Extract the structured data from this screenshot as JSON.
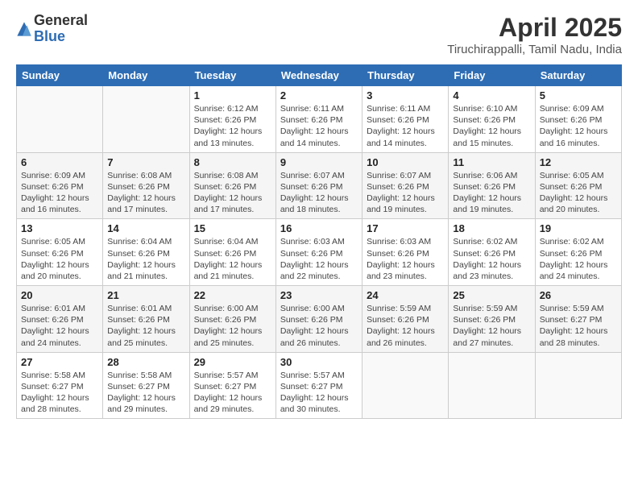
{
  "logo": {
    "general": "General",
    "blue": "Blue"
  },
  "title": "April 2025",
  "subtitle": "Tiruchirappalli, Tamil Nadu, India",
  "days_of_week": [
    "Sunday",
    "Monday",
    "Tuesday",
    "Wednesday",
    "Thursday",
    "Friday",
    "Saturday"
  ],
  "weeks": [
    [
      {
        "day": "",
        "sunrise": "",
        "sunset": "",
        "daylight": ""
      },
      {
        "day": "",
        "sunrise": "",
        "sunset": "",
        "daylight": ""
      },
      {
        "day": "1",
        "sunrise": "Sunrise: 6:12 AM",
        "sunset": "Sunset: 6:26 PM",
        "daylight": "Daylight: 12 hours and 13 minutes."
      },
      {
        "day": "2",
        "sunrise": "Sunrise: 6:11 AM",
        "sunset": "Sunset: 6:26 PM",
        "daylight": "Daylight: 12 hours and 14 minutes."
      },
      {
        "day": "3",
        "sunrise": "Sunrise: 6:11 AM",
        "sunset": "Sunset: 6:26 PM",
        "daylight": "Daylight: 12 hours and 14 minutes."
      },
      {
        "day": "4",
        "sunrise": "Sunrise: 6:10 AM",
        "sunset": "Sunset: 6:26 PM",
        "daylight": "Daylight: 12 hours and 15 minutes."
      },
      {
        "day": "5",
        "sunrise": "Sunrise: 6:09 AM",
        "sunset": "Sunset: 6:26 PM",
        "daylight": "Daylight: 12 hours and 16 minutes."
      }
    ],
    [
      {
        "day": "6",
        "sunrise": "Sunrise: 6:09 AM",
        "sunset": "Sunset: 6:26 PM",
        "daylight": "Daylight: 12 hours and 16 minutes."
      },
      {
        "day": "7",
        "sunrise": "Sunrise: 6:08 AM",
        "sunset": "Sunset: 6:26 PM",
        "daylight": "Daylight: 12 hours and 17 minutes."
      },
      {
        "day": "8",
        "sunrise": "Sunrise: 6:08 AM",
        "sunset": "Sunset: 6:26 PM",
        "daylight": "Daylight: 12 hours and 17 minutes."
      },
      {
        "day": "9",
        "sunrise": "Sunrise: 6:07 AM",
        "sunset": "Sunset: 6:26 PM",
        "daylight": "Daylight: 12 hours and 18 minutes."
      },
      {
        "day": "10",
        "sunrise": "Sunrise: 6:07 AM",
        "sunset": "Sunset: 6:26 PM",
        "daylight": "Daylight: 12 hours and 19 minutes."
      },
      {
        "day": "11",
        "sunrise": "Sunrise: 6:06 AM",
        "sunset": "Sunset: 6:26 PM",
        "daylight": "Daylight: 12 hours and 19 minutes."
      },
      {
        "day": "12",
        "sunrise": "Sunrise: 6:05 AM",
        "sunset": "Sunset: 6:26 PM",
        "daylight": "Daylight: 12 hours and 20 minutes."
      }
    ],
    [
      {
        "day": "13",
        "sunrise": "Sunrise: 6:05 AM",
        "sunset": "Sunset: 6:26 PM",
        "daylight": "Daylight: 12 hours and 20 minutes."
      },
      {
        "day": "14",
        "sunrise": "Sunrise: 6:04 AM",
        "sunset": "Sunset: 6:26 PM",
        "daylight": "Daylight: 12 hours and 21 minutes."
      },
      {
        "day": "15",
        "sunrise": "Sunrise: 6:04 AM",
        "sunset": "Sunset: 6:26 PM",
        "daylight": "Daylight: 12 hours and 21 minutes."
      },
      {
        "day": "16",
        "sunrise": "Sunrise: 6:03 AM",
        "sunset": "Sunset: 6:26 PM",
        "daylight": "Daylight: 12 hours and 22 minutes."
      },
      {
        "day": "17",
        "sunrise": "Sunrise: 6:03 AM",
        "sunset": "Sunset: 6:26 PM",
        "daylight": "Daylight: 12 hours and 23 minutes."
      },
      {
        "day": "18",
        "sunrise": "Sunrise: 6:02 AM",
        "sunset": "Sunset: 6:26 PM",
        "daylight": "Daylight: 12 hours and 23 minutes."
      },
      {
        "day": "19",
        "sunrise": "Sunrise: 6:02 AM",
        "sunset": "Sunset: 6:26 PM",
        "daylight": "Daylight: 12 hours and 24 minutes."
      }
    ],
    [
      {
        "day": "20",
        "sunrise": "Sunrise: 6:01 AM",
        "sunset": "Sunset: 6:26 PM",
        "daylight": "Daylight: 12 hours and 24 minutes."
      },
      {
        "day": "21",
        "sunrise": "Sunrise: 6:01 AM",
        "sunset": "Sunset: 6:26 PM",
        "daylight": "Daylight: 12 hours and 25 minutes."
      },
      {
        "day": "22",
        "sunrise": "Sunrise: 6:00 AM",
        "sunset": "Sunset: 6:26 PM",
        "daylight": "Daylight: 12 hours and 25 minutes."
      },
      {
        "day": "23",
        "sunrise": "Sunrise: 6:00 AM",
        "sunset": "Sunset: 6:26 PM",
        "daylight": "Daylight: 12 hours and 26 minutes."
      },
      {
        "day": "24",
        "sunrise": "Sunrise: 5:59 AM",
        "sunset": "Sunset: 6:26 PM",
        "daylight": "Daylight: 12 hours and 26 minutes."
      },
      {
        "day": "25",
        "sunrise": "Sunrise: 5:59 AM",
        "sunset": "Sunset: 6:26 PM",
        "daylight": "Daylight: 12 hours and 27 minutes."
      },
      {
        "day": "26",
        "sunrise": "Sunrise: 5:59 AM",
        "sunset": "Sunset: 6:27 PM",
        "daylight": "Daylight: 12 hours and 28 minutes."
      }
    ],
    [
      {
        "day": "27",
        "sunrise": "Sunrise: 5:58 AM",
        "sunset": "Sunset: 6:27 PM",
        "daylight": "Daylight: 12 hours and 28 minutes."
      },
      {
        "day": "28",
        "sunrise": "Sunrise: 5:58 AM",
        "sunset": "Sunset: 6:27 PM",
        "daylight": "Daylight: 12 hours and 29 minutes."
      },
      {
        "day": "29",
        "sunrise": "Sunrise: 5:57 AM",
        "sunset": "Sunset: 6:27 PM",
        "daylight": "Daylight: 12 hours and 29 minutes."
      },
      {
        "day": "30",
        "sunrise": "Sunrise: 5:57 AM",
        "sunset": "Sunset: 6:27 PM",
        "daylight": "Daylight: 12 hours and 30 minutes."
      },
      {
        "day": "",
        "sunrise": "",
        "sunset": "",
        "daylight": ""
      },
      {
        "day": "",
        "sunrise": "",
        "sunset": "",
        "daylight": ""
      },
      {
        "day": "",
        "sunrise": "",
        "sunset": "",
        "daylight": ""
      }
    ]
  ]
}
